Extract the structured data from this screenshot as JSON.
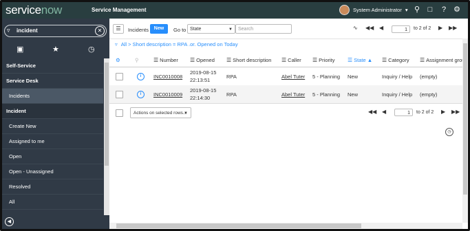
{
  "brand": {
    "logo_text": "servicenow",
    "app_title": "Service Management"
  },
  "header": {
    "user_name": "System Administrator",
    "user_caret": "▾",
    "icons": [
      "search-icon",
      "chat-icon",
      "help-icon",
      "gear-icon"
    ]
  },
  "sidebar": {
    "filter_value": "incident",
    "tabs": [
      "all-apps-icon",
      "favorites-star-icon",
      "history-clock-icon"
    ],
    "items": [
      {
        "label": "Self-Service",
        "kind": "section"
      },
      {
        "label": "Service Desk",
        "kind": "section"
      },
      {
        "label": "Incidents",
        "kind": "sub-active"
      },
      {
        "label": "Incident",
        "kind": "module"
      },
      {
        "label": "Create New",
        "kind": "item"
      },
      {
        "label": "Assigned to me",
        "kind": "item"
      },
      {
        "label": "Open",
        "kind": "item"
      },
      {
        "label": "Open - Unassigned",
        "kind": "item"
      },
      {
        "label": "Resolved",
        "kind": "item"
      },
      {
        "label": "All",
        "kind": "item"
      }
    ]
  },
  "list": {
    "title": "Incidents",
    "new_label": "New",
    "goto_label": "Go to",
    "goto_field": "State",
    "search_placeholder": "Search",
    "page_value": "1",
    "page_total": "to 2 of 2",
    "breadcrumb": "All > Short description = RPA .or. Opened on Today",
    "columns": [
      "Number",
      "Opened",
      "Short description",
      "Caller",
      "Priority",
      "State",
      "Category",
      "Assignment group"
    ],
    "sorted_column": "State",
    "sort_direction": "▲",
    "rows": [
      {
        "number": "INC0010008",
        "opened_date": "2019-08-15",
        "opened_time": "22:13:51",
        "short_description": "RPA",
        "caller": "Abel Tuter",
        "priority": "5 - Planning",
        "state": "New",
        "category": "Inquiry / Help",
        "assignment_group": "(empty)"
      },
      {
        "number": "INC0010009",
        "opened_date": "2019-08-15",
        "opened_time": "22:14:30",
        "short_description": "RPA",
        "caller": "Abel Tuter",
        "priority": "5 - Planning",
        "state": "New",
        "category": "Inquiry / Help",
        "assignment_group": "(empty)"
      }
    ],
    "actions_label": "Actions on selected rows...",
    "footer_page_value": "1",
    "footer_page_total": "to 2 of 2"
  }
}
